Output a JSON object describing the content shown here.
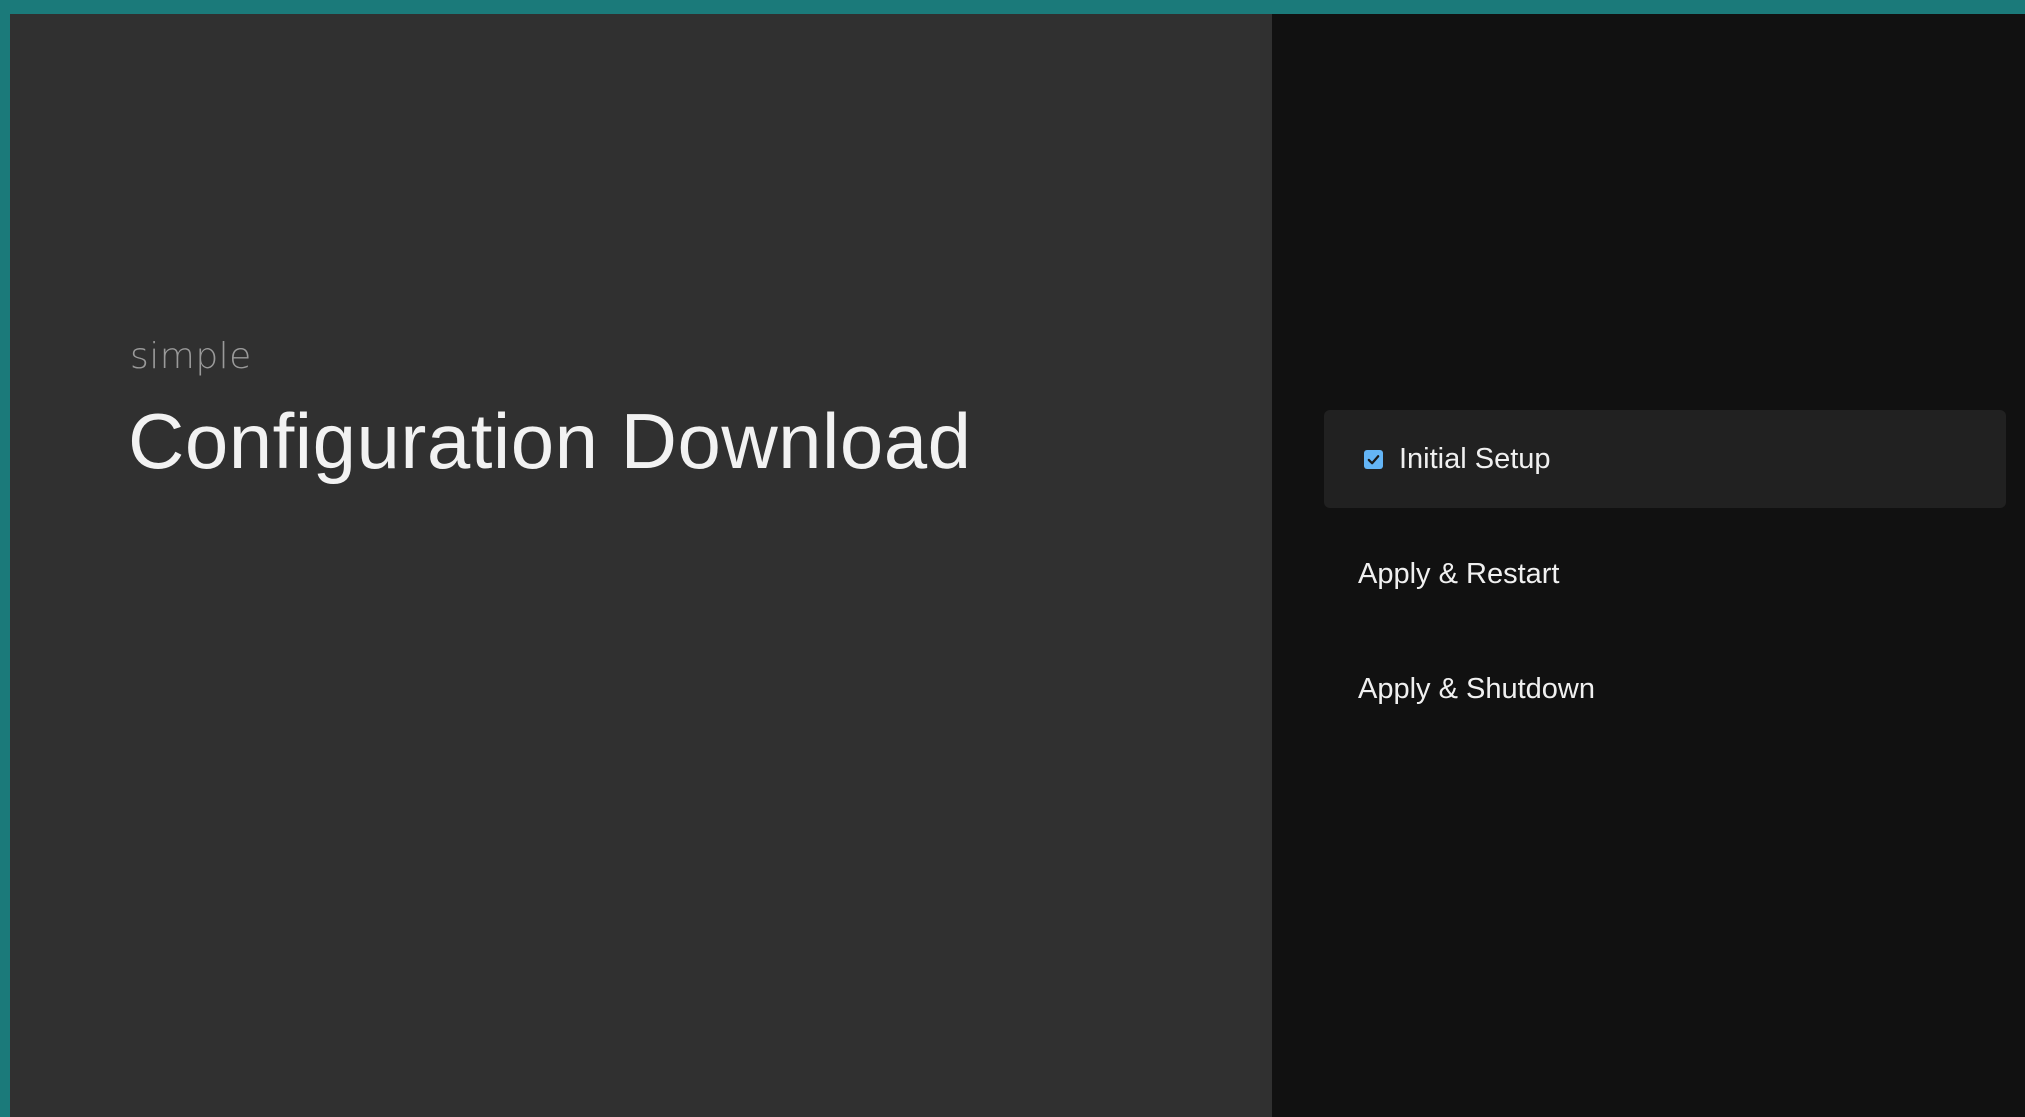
{
  "guidance": {
    "breadcrumb": "simple",
    "title": "Configuration Download"
  },
  "actions": {
    "items": [
      {
        "label": "Initial Setup",
        "checked": true,
        "selected": true
      },
      {
        "label": "Apply & Restart",
        "checked": false,
        "selected": false
      },
      {
        "label": "Apply & Shutdown",
        "checked": false,
        "selected": false
      }
    ]
  },
  "colors": {
    "accent_frame": "#1b7a7a",
    "guidance_bg": "#303030",
    "actions_bg": "#111111",
    "selected_item_bg": "#212121",
    "checkbox": "#64b5f6"
  },
  "icons": {
    "checkbox": "checkbox-checked-icon"
  }
}
